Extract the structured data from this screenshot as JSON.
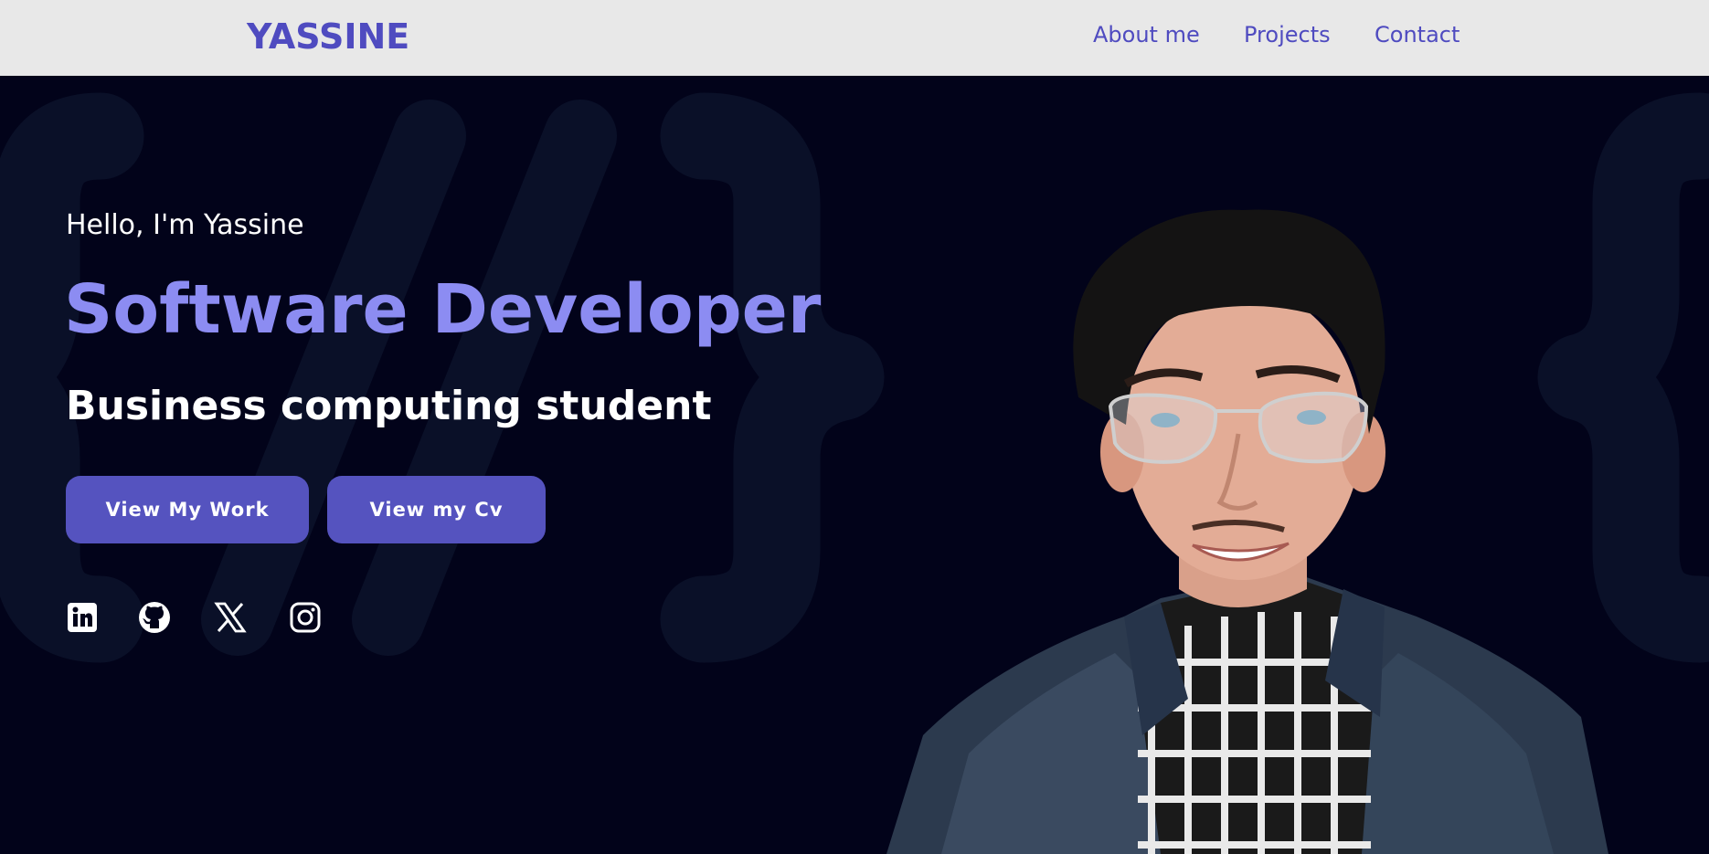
{
  "nav": {
    "logo": "YASSINE",
    "links": [
      "About me",
      "Projects",
      "Contact"
    ]
  },
  "hero": {
    "greeting": "Hello, I'm Yassine",
    "title": "Software Developer",
    "subtitle": "Business computing student",
    "buttons": [
      "View My Work",
      "View my Cv"
    ]
  },
  "socials": {
    "icons": [
      "linkedin-icon",
      "github-icon",
      "x-icon",
      "instagram-icon"
    ]
  },
  "colors": {
    "accent": "#4f4bc0",
    "title": "#8c8cf2",
    "button": "#5553bf",
    "background": "#02031a",
    "navbar": "#e8e8e8"
  }
}
